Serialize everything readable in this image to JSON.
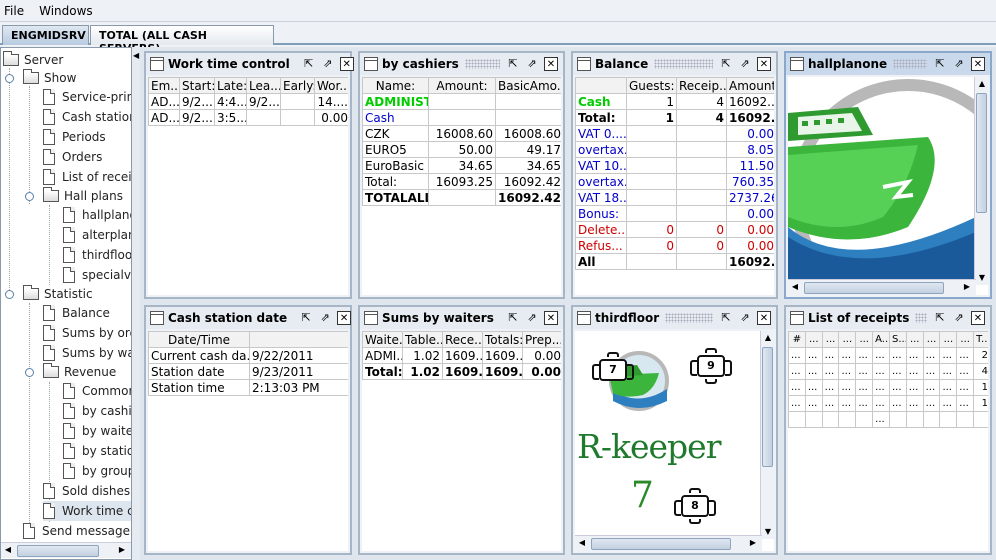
{
  "menu": {
    "file": "File",
    "windows": "Windows"
  },
  "tabs": [
    "ENGMIDSRV",
    "TOTAL (ALL CASH SERVERS)"
  ],
  "tree": {
    "server": "Server",
    "show": "Show",
    "service_print": "Service-print",
    "cash_station": "Cash station",
    "periods": "Periods",
    "orders": "Orders",
    "list_of_receipts": "List of receip",
    "hall_plans": "Hall plans",
    "hallplanone": "hallplanone",
    "alterplan": "alterplan",
    "thirdfloor": "thirdfloor",
    "specialvi": "specialvi",
    "statistic": "Statistic",
    "balance": "Balance",
    "sums_by_orders": "Sums by ord",
    "sums_by_waiters": "Sums by wa",
    "revenue": "Revenue",
    "common": "Common",
    "by_cashiers": "by cashie",
    "by_waiters": "by waiter",
    "by_station": "by station",
    "by_group": "by group",
    "sold_dishes": "Sold dishes",
    "work_time": "Work time co",
    "send_message": "Send message"
  },
  "colors": {
    "green": "#00cc00",
    "blue": "#0000cc",
    "red": "#dd0000",
    "accent": "#8aa7cc"
  },
  "windows": {
    "work_time": {
      "title": "Work time control",
      "headers": [
        "Em...",
        "Start:",
        "Late:",
        "Lea...",
        "Early:",
        "Wor..."
      ],
      "rows": [
        [
          "AD...",
          "9/2...",
          "4:4...",
          "9/2...",
          "",
          "14...."
        ],
        [
          "AD...",
          "9/2...",
          "3:5...",
          "",
          "",
          "0.00"
        ]
      ]
    },
    "by_cashiers": {
      "title": "by cashiers",
      "headers": [
        "Name:",
        "Amount:",
        "BasicAmo..."
      ],
      "rows": [
        [
          "ADMINIST...",
          "",
          ""
        ],
        [
          "Cash",
          "",
          ""
        ],
        [
          "CZK",
          "16008.60",
          "16008.60"
        ],
        [
          "EURO5",
          "50.00",
          "49.17"
        ],
        [
          "EuroBasic",
          "34.65",
          "34.65"
        ],
        [
          "Total:",
          "16093.25",
          "16092.42"
        ],
        [
          "TOTALALL:",
          "",
          "16092.42"
        ]
      ]
    },
    "balance": {
      "title": "Balance",
      "headers": [
        "",
        "Guests:",
        "Receip...",
        "Amount:"
      ],
      "rows": [
        [
          "Cash",
          "1",
          "4",
          "16092...."
        ],
        [
          "Total:",
          "1",
          "4",
          "16092...."
        ],
        [
          "VAT 0....",
          "",
          "",
          "0.00"
        ],
        [
          "overtax...",
          "",
          "",
          "8.05"
        ],
        [
          "VAT 10...",
          "",
          "",
          "11.50"
        ],
        [
          "overtax...",
          "",
          "",
          "760.35"
        ],
        [
          "VAT 18...",
          "",
          "",
          "2737.26"
        ],
        [
          "Bonus:",
          "",
          "",
          "0.00"
        ],
        [
          "Delete...",
          "0",
          "0",
          "0.00"
        ],
        [
          "Refus...",
          "0",
          "0",
          "0.00"
        ],
        [
          "All",
          "",
          "",
          "16092...."
        ]
      ]
    },
    "hallplanone": {
      "title": "hallplanone"
    },
    "cash_station_date": {
      "title": "Cash station date",
      "headers": [
        "Date/Time",
        ""
      ],
      "rows": [
        [
          "Current cash da...",
          "9/22/2011"
        ],
        [
          "Station date",
          "9/23/2011"
        ],
        [
          "Station time",
          "2:13:03 PM"
        ]
      ]
    },
    "sums_by_waiters": {
      "title": "Sums by waiters",
      "headers": [
        "Waite...",
        "Table...",
        "Rece...",
        "Totals:",
        "Prep..."
      ],
      "rows": [
        [
          "ADMI...",
          "1.02",
          "1609...",
          "1609...",
          "0.00"
        ],
        [
          "Total:",
          "1.02",
          "1609...",
          "1609...",
          "0.00"
        ]
      ]
    },
    "thirdfloor": {
      "title": "thirdfloor",
      "tables": [
        "7",
        "9",
        "8"
      ],
      "logo_text": "R-keeper",
      "logo_num": "7"
    },
    "list_of_receipts": {
      "title": "List of receipts",
      "headers": [
        "#",
        "...",
        "...",
        "...",
        "...",
        "A...",
        "S...",
        "...",
        "...",
        "...",
        "...",
        "T..."
      ],
      "rows": [
        [
          "...",
          "...",
          "...",
          "...",
          "...",
          "...",
          "...",
          "...",
          "...",
          "...",
          "...",
          "2"
        ],
        [
          "...",
          "...",
          "...",
          "...",
          "...",
          "...",
          "...",
          "...",
          "...",
          "...",
          "...",
          "4"
        ],
        [
          "...",
          "...",
          "...",
          "...",
          "...",
          "...",
          "...",
          "...",
          "...",
          "...",
          "...",
          "1"
        ],
        [
          "...",
          "...",
          "...",
          "...",
          "...",
          "...",
          "...",
          "...",
          "...",
          "...",
          "...",
          "1"
        ],
        [
          "",
          "",
          "",
          "",
          "",
          "...",
          "",
          "",
          "",
          "",
          "",
          ""
        ]
      ]
    }
  }
}
